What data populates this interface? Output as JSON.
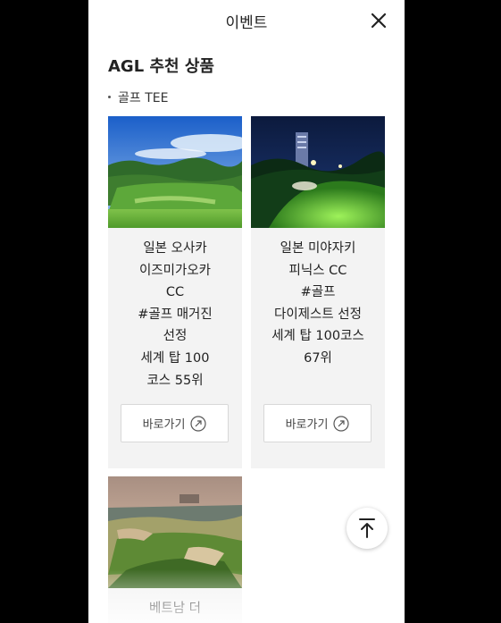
{
  "header": {
    "title": "이벤트"
  },
  "section": {
    "title": "AGL 추천 상품",
    "subtitle": "골프 TEE"
  },
  "cards": [
    {
      "lines": [
        "일본 오사카",
        "이즈미가오카",
        "CC",
        "#골프 매거진",
        "선정",
        "세계 탑 100",
        "코스 55위"
      ],
      "button": "바로가기"
    },
    {
      "lines": [
        "일본 미야자키",
        "피닉스 CC",
        "#골프",
        "다이제스트 선정",
        "세계 탑 100코스",
        "67위"
      ],
      "button": "바로가기"
    },
    {
      "lines": [
        "베트남 더"
      ]
    }
  ],
  "icons": {
    "close": "close-icon",
    "arrow": "arrow-up-right-circle-icon",
    "top": "arrow-up-to-top-icon"
  }
}
